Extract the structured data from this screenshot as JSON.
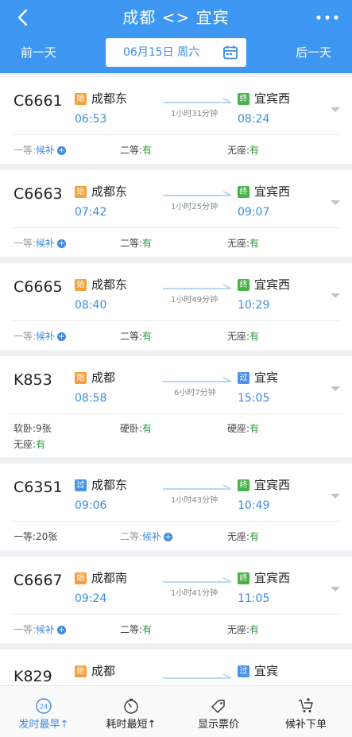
{
  "header": {
    "title": "成都 <> 宜宾",
    "prev_day": "前一天",
    "next_day": "后一天",
    "date": "06月15日 周六",
    "accent_color": "#3d97f0"
  },
  "badges": {
    "start": "始",
    "end": "终",
    "pass": "过"
  },
  "trains": [
    {
      "no": "C6661",
      "from_badge": "始",
      "from": "成都东",
      "dep": "06:53",
      "duration": "1小时31分钟",
      "to_badge": "终",
      "to": "宜宾西",
      "arr": "08:24",
      "seats": [
        {
          "label": "一等:",
          "value": "候补",
          "waitlist": true
        },
        {
          "label": "二等:",
          "value": "有"
        },
        {
          "label": "无座:",
          "value": "有"
        }
      ]
    },
    {
      "no": "C6663",
      "from_badge": "始",
      "from": "成都东",
      "dep": "07:42",
      "duration": "1小时25分钟",
      "to_badge": "终",
      "to": "宜宾西",
      "arr": "09:07",
      "seats": [
        {
          "label": "一等:",
          "value": "候补",
          "waitlist": true
        },
        {
          "label": "二等:",
          "value": "有"
        },
        {
          "label": "无座:",
          "value": "有"
        }
      ]
    },
    {
      "no": "C6665",
      "from_badge": "始",
      "from": "成都东",
      "dep": "08:40",
      "duration": "1小时49分钟",
      "to_badge": "终",
      "to": "宜宾西",
      "arr": "10:29",
      "seats": [
        {
          "label": "一等:",
          "value": "候补",
          "waitlist": true
        },
        {
          "label": "二等:",
          "value": "有"
        },
        {
          "label": "无座:",
          "value": "有"
        }
      ]
    },
    {
      "no": "K853",
      "from_badge": "始",
      "from": "成都",
      "dep": "08:58",
      "duration": "6小时7分钟",
      "to_badge": "过",
      "to": "宜宾",
      "arr": "15:05",
      "seats": [
        {
          "label": "软卧:",
          "value": "9张",
          "count": true
        },
        {
          "label": "硬卧:",
          "value": "有"
        },
        {
          "label": "硬座:",
          "value": "有"
        },
        {
          "label": "无座:",
          "value": "有"
        }
      ]
    },
    {
      "no": "C6351",
      "from_badge": "过",
      "from": "成都东",
      "dep": "09:06",
      "duration": "1小时43分钟",
      "to_badge": "终",
      "to": "宜宾西",
      "arr": "10:49",
      "seats": [
        {
          "label": "一等:",
          "value": "20张",
          "count": true
        },
        {
          "label": "二等:",
          "value": "候补",
          "waitlist": true
        },
        {
          "label": "无座:",
          "value": "有"
        }
      ]
    },
    {
      "no": "C6667",
      "from_badge": "始",
      "from": "成都南",
      "dep": "09:24",
      "duration": "1小时41分钟",
      "to_badge": "终",
      "to": "宜宾西",
      "arr": "11:05",
      "seats": [
        {
          "label": "一等:",
          "value": "候补",
          "waitlist": true
        },
        {
          "label": "二等:",
          "value": "有"
        },
        {
          "label": "无座:",
          "value": "有"
        }
      ]
    },
    {
      "no": "K829",
      "from_badge": "始",
      "from": "成都",
      "to_badge": "过",
      "to": "宜宾"
    }
  ],
  "tabbar": {
    "sort_depart": "发时最早↑",
    "sort_duration": "耗时最短↑",
    "show_price": "显示票价",
    "waitlist_order": "候补下单",
    "depart_icon_text": "24"
  }
}
